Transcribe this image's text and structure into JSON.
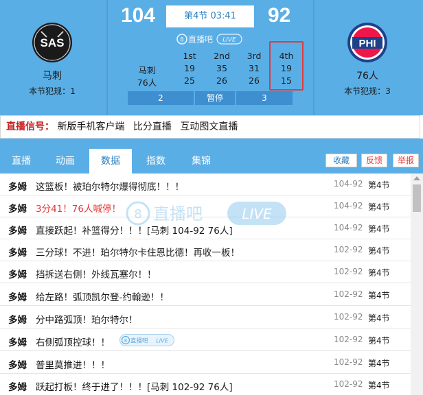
{
  "home": {
    "abbr": "SAS",
    "name": "马刺",
    "fouls": "本节犯规：1",
    "score": "104"
  },
  "away": {
    "abbr": "PHI",
    "name": "76人",
    "fouls": "本节犯规：3",
    "score": "92"
  },
  "clock": "第4节 03:41",
  "brand": "直播吧",
  "live": "LIVE",
  "quarters": {
    "headers": [
      "1st",
      "2nd",
      "3rd",
      "4th"
    ],
    "home_row": {
      "name": "马刺",
      "scores": [
        "19",
        "35",
        "31",
        "19"
      ]
    },
    "away_row": {
      "name": "76人",
      "scores": [
        "25",
        "26",
        "26",
        "15"
      ]
    }
  },
  "timeouts": {
    "home": "2",
    "label": "暂停",
    "away": "3"
  },
  "signal": {
    "label": "直播信号：",
    "links": [
      "新版手机客户端",
      "比分直播",
      "互动图文直播"
    ]
  },
  "tabs": [
    "直播",
    "动画",
    "数据",
    "指数",
    "集锦"
  ],
  "active_tab": "数据",
  "actions": {
    "favorite": "收藏",
    "feedback": "反馈",
    "report": "举报"
  },
  "feed": [
    {
      "who": "多姆",
      "text": "这篮板！被珀尔特尔爆得彻底！！！",
      "score": "104-92",
      "quarter": "第4节"
    },
    {
      "who": "多姆",
      "text": "3分41！76人喊停！",
      "score": "104-92",
      "quarter": "第4节",
      "highlight": true
    },
    {
      "who": "多姆",
      "text": "直接跃起！补篮得分！！！[马刺 104-92 76人]",
      "score": "104-92",
      "quarter": "第4节"
    },
    {
      "who": "多姆",
      "text": "三分球！不进！珀尔特尔卡住恩比德！再收一板！",
      "score": "102-92",
      "quarter": "第4节"
    },
    {
      "who": "多姆",
      "text": "挡拆送右侧！外线瓦塞尔！！",
      "score": "102-92",
      "quarter": "第4节"
    },
    {
      "who": "多姆",
      "text": "给左路！弧顶凯尔登-约翰逊！！",
      "score": "102-92",
      "quarter": "第4节"
    },
    {
      "who": "多姆",
      "text": "分中路弧顶！珀尔特尔！",
      "score": "102-92",
      "quarter": "第4节"
    },
    {
      "who": "多姆",
      "text": "右侧弧顶控球！！",
      "score": "102-92",
      "quarter": "第4节"
    },
    {
      "who": "多姆",
      "text": "普里莫推进！！！",
      "score": "102-92",
      "quarter": "第4节"
    },
    {
      "who": "多姆",
      "text": "跃起打板！终于进了！！！[马刺 102-92 76人]",
      "score": "102-92",
      "quarter": "第4节"
    }
  ],
  "colors": {
    "header_blue": "#5aaee6",
    "accent_blue": "#2a7fc2",
    "red": "#e23a3a"
  }
}
